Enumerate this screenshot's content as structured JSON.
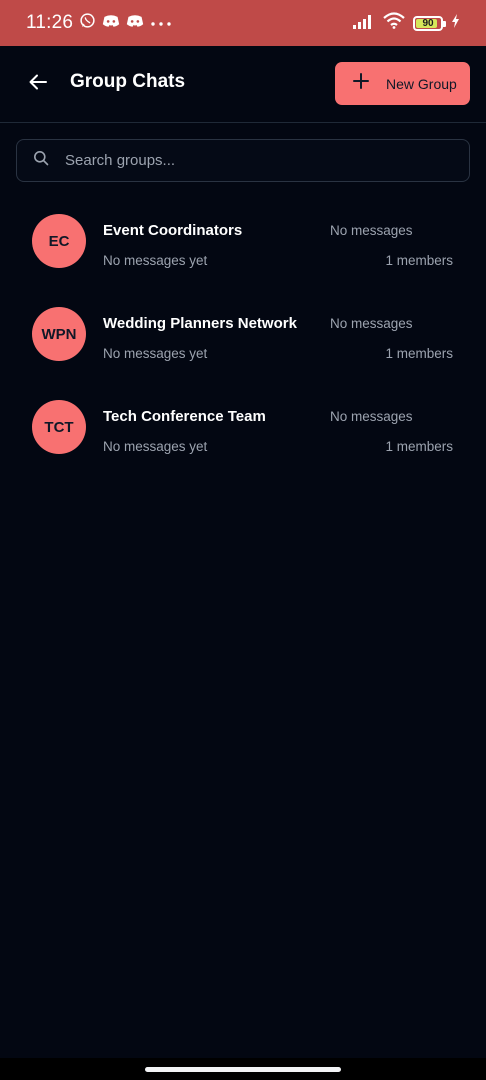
{
  "status_bar": {
    "time": "11:26",
    "battery": "90",
    "icons": [
      "whatsapp-icon",
      "discord-icon",
      "discord-icon",
      "more-dots-icon",
      "signal-icon",
      "wifi-icon",
      "battery-icon",
      "charging-icon"
    ]
  },
  "header": {
    "title": "Group Chats",
    "new_group_label": "New Group"
  },
  "search": {
    "placeholder": "Search groups..."
  },
  "groups": [
    {
      "initials": "EC",
      "name": "Event Coordinators",
      "last_message": "No messages yet",
      "time": "No messages",
      "members": "1 members"
    },
    {
      "initials": "WPN",
      "name": "Wedding Planners Network",
      "last_message": "No messages yet",
      "time": "No messages",
      "members": "1 members"
    },
    {
      "initials": "TCT",
      "name": "Tech Conference Team",
      "last_message": "No messages yet",
      "time": "No messages",
      "members": "1 members"
    }
  ],
  "colors": {
    "status_bar": "#bf4a48",
    "background": "#030712",
    "accent": "#f87171",
    "muted_text": "#9ca3af"
  }
}
